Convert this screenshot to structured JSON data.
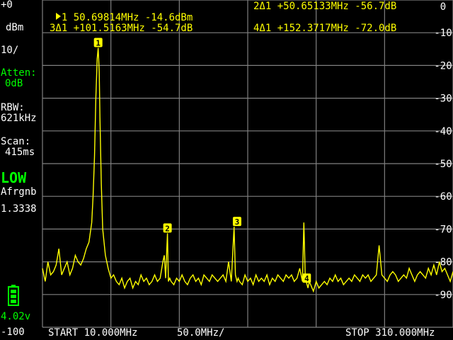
{
  "sidebar": {
    "ref_level": "+0",
    "unit": "dBm",
    "scale": "10/",
    "atten_label": "Atten:",
    "atten_value": "0dB",
    "rbw_label": "RBW:",
    "rbw_value": "621kHz",
    "scan_label": "Scan:",
    "scan_value": "415ms",
    "mode": "LOW",
    "agc_label": "Afrgnb",
    "agc_value": "1.3338",
    "voltage": "4.02v",
    "bottom_level": "-100"
  },
  "markers_header": {
    "m1": "1 50.69814MHz -14.6dBm",
    "m2": "2Δ1 +50.65133MHz -56.7dB",
    "m3": "3Δ1 +101.5163MHz -54.7dB",
    "m4": "4Δ1 +152.3717MHz -72.0dB"
  },
  "y_axis": {
    "labels": [
      "0",
      "-10",
      "-20",
      "-30",
      "-40",
      "-50",
      "-60",
      "-70",
      "-80",
      "-90"
    ]
  },
  "footer": {
    "start": "START 10.000MHz",
    "per_div": "50.0MHz/",
    "stop": "STOP 310.000MHz"
  },
  "colors": {
    "trace": "#ffff00",
    "grid": "#808080",
    "marker_text": "#ffff00",
    "accent_green": "#00ff00"
  },
  "chart_data": {
    "type": "line",
    "x_unit": "MHz",
    "y_unit": "dBm",
    "xlim": [
      10,
      310
    ],
    "ylim": [
      -100,
      0
    ],
    "grid": true,
    "markers": [
      {
        "id": "1",
        "freq_mhz": 50.69814,
        "level_dbm": -14.6
      },
      {
        "id": "2",
        "freq_mhz": 101.34947,
        "level_dbm": -71.3
      },
      {
        "id": "3",
        "freq_mhz": 152.21444,
        "level_dbm": -69.3
      },
      {
        "id": "4",
        "freq_mhz": 203.06984,
        "level_dbm": -86.6
      }
    ],
    "trace": {
      "x": [
        10,
        12,
        14,
        16,
        18,
        20,
        22,
        24,
        26,
        28,
        30,
        32,
        34,
        36,
        38,
        40,
        42,
        44,
        46,
        47,
        48,
        49,
        50,
        50.7,
        51.5,
        52,
        53,
        54,
        56,
        58,
        60,
        62,
        64,
        66,
        68,
        70,
        72,
        74,
        76,
        78,
        80,
        82,
        84,
        86,
        88,
        90,
        92,
        94,
        96,
        98,
        99,
        100,
        101.35,
        102,
        103,
        104,
        106,
        108,
        110,
        112,
        114,
        116,
        118,
        120,
        122,
        124,
        126,
        128,
        130,
        132,
        134,
        136,
        138,
        140,
        142,
        144,
        146,
        148,
        150,
        151,
        152.21,
        153,
        154,
        156,
        158,
        160,
        162,
        164,
        166,
        168,
        170,
        172,
        174,
        176,
        178,
        180,
        182,
        184,
        186,
        188,
        190,
        192,
        194,
        196,
        198,
        200,
        201,
        202,
        203.07,
        204,
        205,
        206,
        208,
        210,
        212,
        214,
        216,
        218,
        220,
        222,
        224,
        226,
        228,
        230,
        232,
        234,
        236,
        238,
        240,
        242,
        244,
        246,
        248,
        250,
        252,
        254,
        256,
        258,
        260,
        262,
        264,
        266,
        268,
        270,
        272,
        274,
        276,
        278,
        280,
        282,
        284,
        286,
        288,
        290,
        292,
        294,
        296,
        298,
        300,
        302,
        304,
        306,
        308,
        310
      ],
      "y": [
        -82,
        -86,
        -80,
        -84,
        -83,
        -81,
        -76,
        -84,
        -82,
        -80,
        -84,
        -82,
        -78,
        -80,
        -81,
        -79,
        -76,
        -74,
        -68,
        -60,
        -48,
        -30,
        -18,
        -14.6,
        -22,
        -36,
        -56,
        -70,
        -78,
        -82,
        -85,
        -84,
        -86,
        -87,
        -85,
        -88,
        -86,
        -85,
        -88,
        -86,
        -87,
        -84,
        -86,
        -85,
        -87,
        -86,
        -84,
        -86,
        -85,
        -80,
        -78,
        -85,
        -71.3,
        -86,
        -85,
        -86,
        -87,
        -85,
        -86,
        -84,
        -86,
        -87,
        -85,
        -84,
        -86,
        -85,
        -87,
        -84,
        -85,
        -86,
        -84,
        -85,
        -86,
        -85,
        -84,
        -86,
        -80,
        -86,
        -69.3,
        -84,
        -86,
        -85,
        -86,
        -87,
        -84,
        -86,
        -85,
        -87,
        -84,
        -86,
        -85,
        -86,
        -84,
        -87,
        -85,
        -86,
        -84,
        -85,
        -86,
        -84,
        -85,
        -84,
        -86,
        -85,
        -82,
        -86,
        -68,
        -84,
        -86.6,
        -88,
        -86,
        -87,
        -89,
        -86,
        -88,
        -87,
        -86,
        -87,
        -85,
        -86,
        -84,
        -86,
        -85,
        -87,
        -86,
        -85,
        -86,
        -84,
        -85,
        -86,
        -84,
        -85,
        -84,
        -86,
        -85,
        -84,
        -75,
        -84,
        -85,
        -86,
        -84,
        -83,
        -84,
        -86,
        -85,
        -84,
        -85,
        -82,
        -84,
        -86,
        -84,
        -83,
        -84,
        -85,
        -82,
        -84,
        -81,
        -84,
        -80,
        -83,
        -82,
        -84,
        -86,
        -83,
        -84
      ]
    }
  }
}
